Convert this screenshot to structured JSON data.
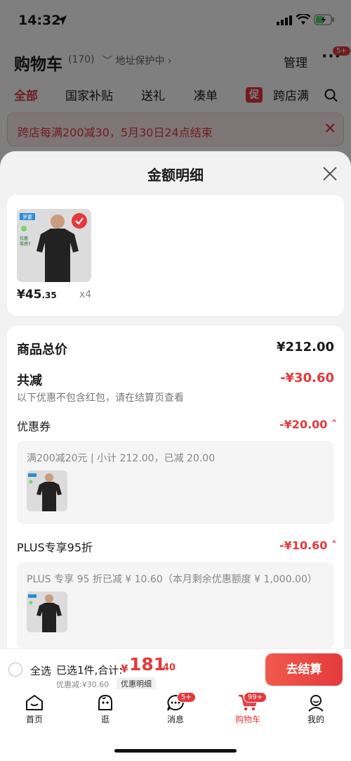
{
  "status_bar": {
    "time": "14:32"
  },
  "cart_header": {
    "title": "购物车",
    "count": "(170)",
    "address": "地址保护中",
    "manage": "管理",
    "more_badge": "5+"
  },
  "tabs": [
    "全部",
    "国家补贴",
    "送礼",
    "凑单",
    "跨店满"
  ],
  "tab_promo_tag": "促",
  "promo_banner": "跨店每满200减30，5月30日24点结束",
  "sheet": {
    "title": "金额明细",
    "product": {
      "price_int": "¥45",
      "price_dec": ".35",
      "qty": "x4",
      "img_brand": "罗蒙",
      "img_tags": [
        "抗菌",
        "零感T"
      ]
    },
    "total_label": "商品总价",
    "total_value": "¥212.00",
    "reduce_label": "共减",
    "reduce_value": "-¥30.60",
    "note": "以下优惠不包含红包，请在结算页查看",
    "coupon_label": "优惠券",
    "coupon_value": "-¥20.00",
    "coupon_detail": "满200减20元 | 小计 212.00，已减 20.00",
    "plus_label": "PLUS专享95折",
    "plus_value": "-¥10.60",
    "plus_detail": "PLUS 专享 95 折已减 ¥ 10.60（本月剩余优惠额度 ¥ 1,000.00）"
  },
  "checkout": {
    "select_all": "全选",
    "selected_info": "已选1件,合计:",
    "total_yen": "¥",
    "total_int": "181",
    "total_dec": ".40",
    "discount_info": "优惠减:¥30.60",
    "detail_link": "优惠明细",
    "button": "去结算"
  },
  "tabbar": [
    {
      "label": "首页"
    },
    {
      "label": "逛"
    },
    {
      "label": "消息",
      "badge": "5+"
    },
    {
      "label": "购物车",
      "badge": "99+"
    },
    {
      "label": "我的"
    }
  ],
  "colors": {
    "accent": "#e4393c"
  }
}
